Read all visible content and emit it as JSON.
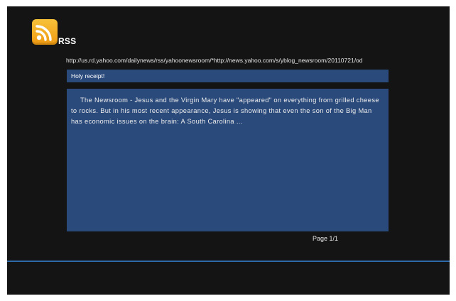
{
  "header": {
    "icon": "rss-icon",
    "title": "RSS"
  },
  "feed": {
    "url": "http://us.rd.yahoo.com/dailynews/rss/yahoonewsroom/*http://news.yahoo.com/s/yblog_newsroom/20110721/od"
  },
  "article": {
    "title": "Holy receipt!",
    "body": "The Newsroom - Jesus and the Virgin Mary have \"appeared\" on everything from grilled cheese to rocks. But in his most recent appearance, Jesus is showing that even the son of the Big Man has economic issues on the brain: A South Carolina ..."
  },
  "pagination": {
    "label": "Page 1/1"
  },
  "colors": {
    "background": "#141414",
    "panel": "#2a4a7c",
    "accent_line": "#2f6aa8",
    "rss_orange": "#f0a01a"
  }
}
